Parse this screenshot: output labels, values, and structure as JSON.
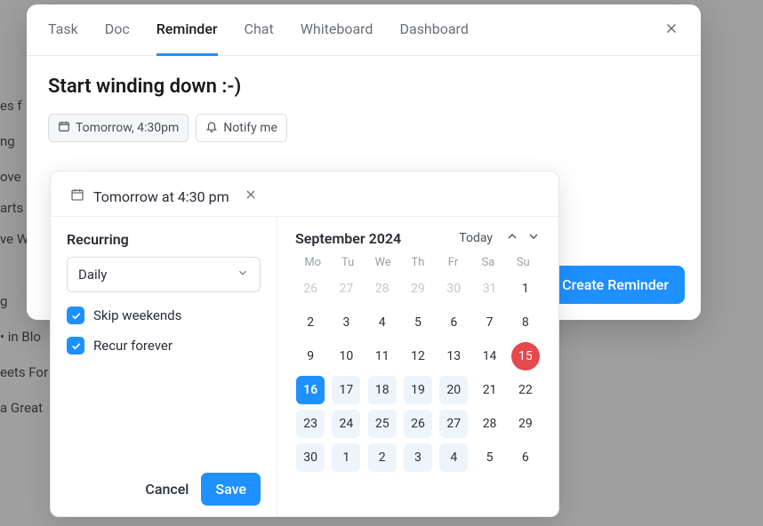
{
  "background_fragments": [
    "es f",
    "ng",
    "ove",
    "arts",
    "ve W",
    "g",
    "• in Blo",
    "eets For",
    "a Great"
  ],
  "tabs": {
    "items": [
      "Task",
      "Doc",
      "Reminder",
      "Chat",
      "Whiteboard",
      "Dashboard"
    ],
    "active_index": 2
  },
  "title": "Start winding down :-)",
  "chips": {
    "datetime": "Tomorrow, 4:30pm",
    "notify": "Notify me"
  },
  "create_button": "Create Reminder",
  "popover": {
    "header_text": "Tomorrow at 4:30 pm",
    "recurring": {
      "label": "Recurring",
      "select_value": "Daily",
      "skip_weekends": {
        "label": "Skip weekends",
        "checked": true
      },
      "recur_forever": {
        "label": "Recur forever",
        "checked": true
      }
    },
    "actions": {
      "cancel": "Cancel",
      "save": "Save"
    },
    "calendar": {
      "month_label": "September 2024",
      "today_label": "Today",
      "dow": [
        "Mo",
        "Tu",
        "We",
        "Th",
        "Fr",
        "Sa",
        "Su"
      ],
      "days": [
        {
          "n": 26,
          "cls": "other"
        },
        {
          "n": 27,
          "cls": "other"
        },
        {
          "n": 28,
          "cls": "other"
        },
        {
          "n": 29,
          "cls": "other"
        },
        {
          "n": 30,
          "cls": "other"
        },
        {
          "n": 31,
          "cls": "other"
        },
        {
          "n": 1,
          "cls": ""
        },
        {
          "n": 2,
          "cls": ""
        },
        {
          "n": 3,
          "cls": ""
        },
        {
          "n": 4,
          "cls": ""
        },
        {
          "n": 5,
          "cls": ""
        },
        {
          "n": 6,
          "cls": ""
        },
        {
          "n": 7,
          "cls": ""
        },
        {
          "n": 8,
          "cls": ""
        },
        {
          "n": 9,
          "cls": ""
        },
        {
          "n": 10,
          "cls": ""
        },
        {
          "n": 11,
          "cls": ""
        },
        {
          "n": 12,
          "cls": ""
        },
        {
          "n": 13,
          "cls": ""
        },
        {
          "n": 14,
          "cls": ""
        },
        {
          "n": 15,
          "cls": "today-red"
        },
        {
          "n": 16,
          "cls": "selected"
        },
        {
          "n": 17,
          "cls": "range"
        },
        {
          "n": 18,
          "cls": "range"
        },
        {
          "n": 19,
          "cls": "range"
        },
        {
          "n": 20,
          "cls": "range"
        },
        {
          "n": 21,
          "cls": ""
        },
        {
          "n": 22,
          "cls": ""
        },
        {
          "n": 23,
          "cls": "range"
        },
        {
          "n": 24,
          "cls": "range"
        },
        {
          "n": 25,
          "cls": "range"
        },
        {
          "n": 26,
          "cls": "range"
        },
        {
          "n": 27,
          "cls": "range"
        },
        {
          "n": 28,
          "cls": ""
        },
        {
          "n": 29,
          "cls": ""
        },
        {
          "n": 30,
          "cls": "range"
        },
        {
          "n": 1,
          "cls": "range"
        },
        {
          "n": 2,
          "cls": "range"
        },
        {
          "n": 3,
          "cls": "range"
        },
        {
          "n": 4,
          "cls": "range"
        },
        {
          "n": 5,
          "cls": ""
        },
        {
          "n": 6,
          "cls": ""
        }
      ]
    }
  }
}
